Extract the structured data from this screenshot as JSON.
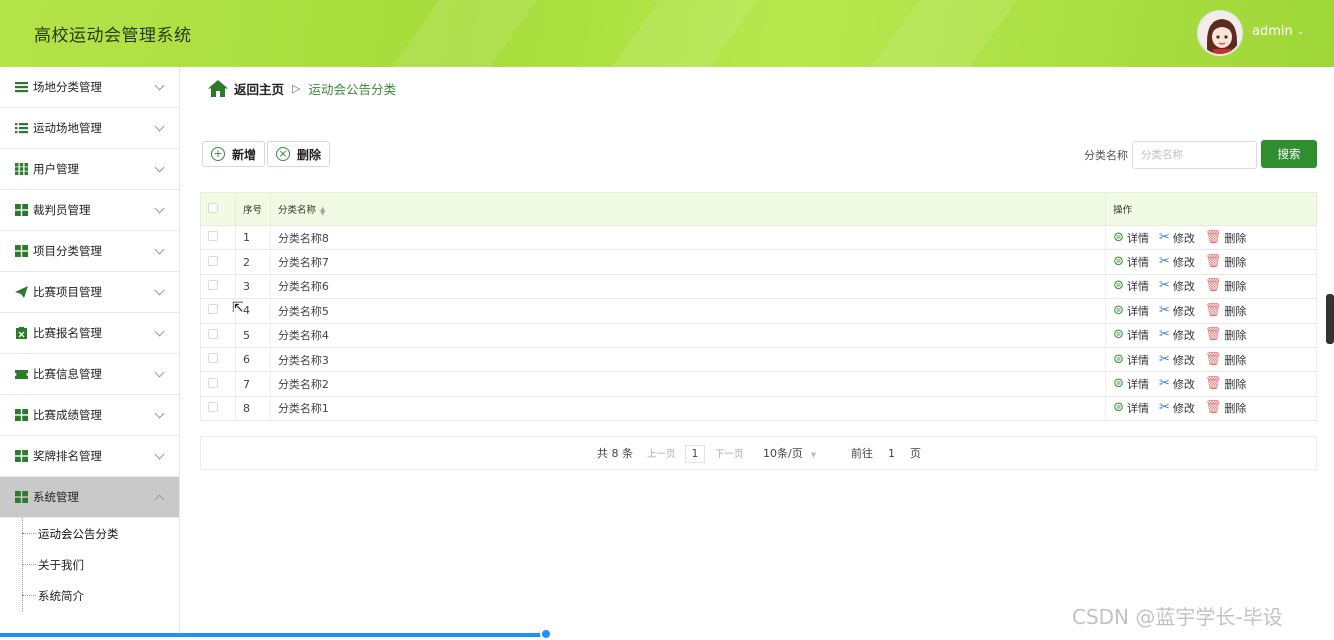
{
  "header": {
    "title": "高校运动会管理系统",
    "user": "admin"
  },
  "sidebar": {
    "items": [
      {
        "label": "场地分类管理",
        "icon": "list-icon"
      },
      {
        "label": "运动场地管理",
        "icon": "list-icon"
      },
      {
        "label": "用户管理",
        "icon": "grid-icon"
      },
      {
        "label": "裁判员管理",
        "icon": "grid-icon"
      },
      {
        "label": "项目分类管理",
        "icon": "grid-icon"
      },
      {
        "label": "比赛项目管理",
        "icon": "send-icon"
      },
      {
        "label": "比赛报名管理",
        "icon": "clipboard-icon"
      },
      {
        "label": "比赛信息管理",
        "icon": "ticket-icon"
      },
      {
        "label": "比赛成绩管理",
        "icon": "grid-icon"
      },
      {
        "label": "奖牌排名管理",
        "icon": "grid-icon"
      },
      {
        "label": "系统管理",
        "icon": "grid-icon"
      }
    ],
    "sub_items": [
      "运动会公告分类",
      "关于我们",
      "系统简介"
    ]
  },
  "breadcrumb": {
    "home": "返回主页",
    "current": "运动会公告分类"
  },
  "toolbar": {
    "add_label": "新增",
    "delete_label": "删除"
  },
  "search": {
    "label": "分类名称",
    "placeholder": "分类名称",
    "button": "搜索"
  },
  "table": {
    "headers": {
      "index": "序号",
      "name": "分类名称",
      "ops": "操作"
    },
    "rows": [
      {
        "index": "1",
        "name": "分类名称8"
      },
      {
        "index": "2",
        "name": "分类名称7"
      },
      {
        "index": "3",
        "name": "分类名称6"
      },
      {
        "index": "4",
        "name": "分类名称5"
      },
      {
        "index": "5",
        "name": "分类名称4"
      },
      {
        "index": "6",
        "name": "分类名称3"
      },
      {
        "index": "7",
        "name": "分类名称2"
      },
      {
        "index": "8",
        "name": "分类名称1"
      }
    ],
    "op_labels": {
      "detail": "详情",
      "edit": "修改",
      "delete": "删除"
    }
  },
  "pager": {
    "total": "共 8 条",
    "prev": "上一页",
    "page": "1",
    "next": "下一页",
    "size": "10条/页",
    "goto": "前往",
    "goto_page": "1",
    "goto_suffix": "页"
  },
  "watermark": "CSDN @蓝宇学长-毕设",
  "colors": {
    "accent": "#2f8f2f",
    "header": "#a6dc3a"
  }
}
